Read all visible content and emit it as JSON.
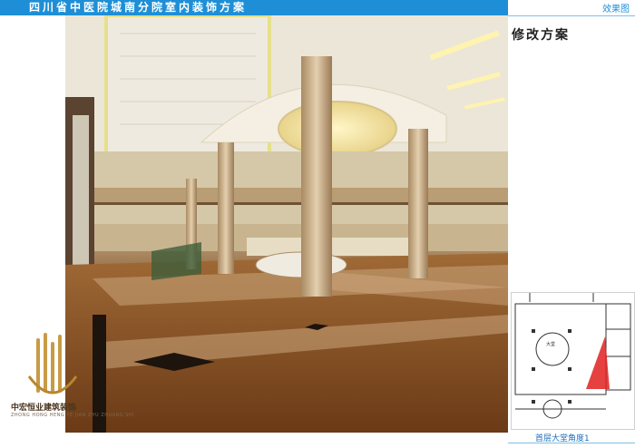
{
  "header": {
    "title": "四川省中医院城南分院室内装饰方案",
    "tag": "效果图"
  },
  "panel": {
    "title": "修改方案",
    "caption": "首层大堂角度1"
  },
  "logo": {
    "name": "中宏恒业建筑装饰",
    "subtitle": "ZHONG HONG HENG YE JIAN ZHU ZHUANG SHI"
  },
  "plan": {
    "room_label": "大堂"
  },
  "colors": {
    "banner": "#1e8fd6",
    "floor": "#8b5a2c",
    "column": "#c9ab82",
    "view_marker": "#e02020"
  }
}
